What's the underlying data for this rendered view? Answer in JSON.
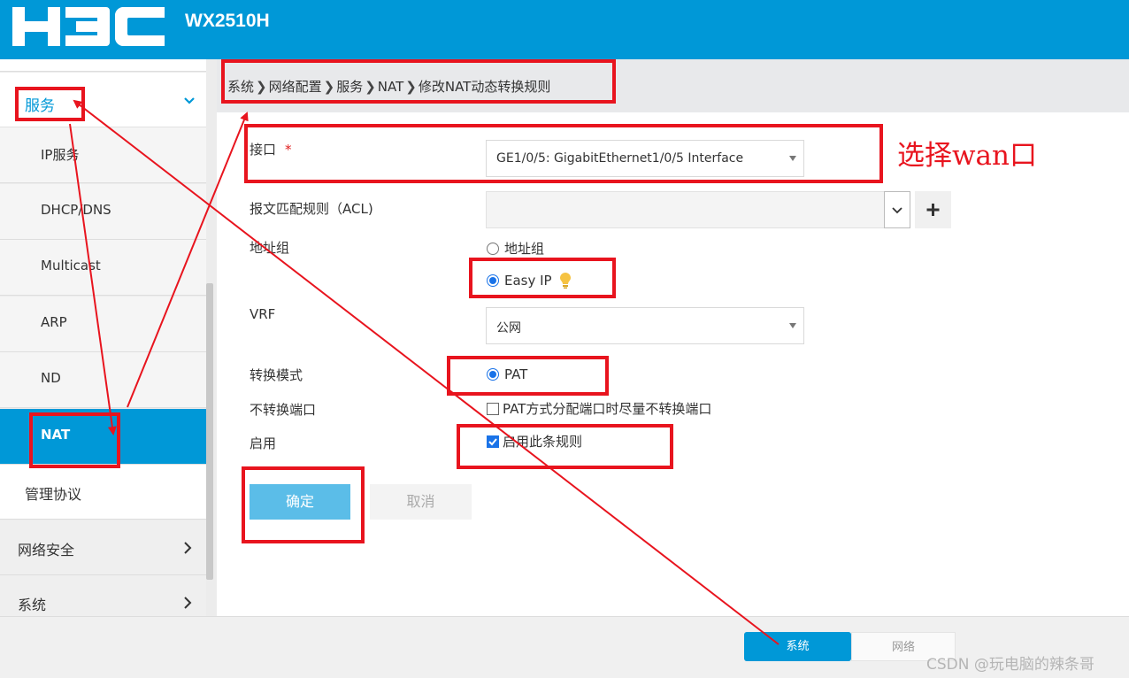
{
  "header": {
    "logo_text": "H3C",
    "model": "WX2510H"
  },
  "sidebar": {
    "service": {
      "label": "服务"
    },
    "sub_items": [
      {
        "label": "IP服务"
      },
      {
        "label": "DHCP/DNS"
      },
      {
        "label": "Multicast"
      },
      {
        "label": "ARP"
      },
      {
        "label": "ND"
      },
      {
        "label": "NAT"
      }
    ],
    "management_protocol": {
      "label": "管理协议"
    },
    "network_security": {
      "label": "网络安全"
    },
    "system": {
      "label": "系统"
    }
  },
  "breadcrumb": {
    "items": [
      "系统",
      "网络配置",
      "服务",
      "NAT",
      "修改NAT动态转换规则"
    ],
    "separator": "❯"
  },
  "form": {
    "interface": {
      "label": "接口",
      "required_mark": "*",
      "value": "GE1/0/5: GigabitEthernet1/0/5 Interface"
    },
    "acl": {
      "label": "报文匹配规则（ACL)",
      "value": "",
      "add_label": "+"
    },
    "address_group": {
      "label": "地址组",
      "option_address_group": "地址组",
      "option_easy_ip": "Easy IP",
      "selected": "Easy IP"
    },
    "vrf": {
      "label": "VRF",
      "value": "公网"
    },
    "translation_mode": {
      "label": "转换模式",
      "option": "PAT",
      "selected": "PAT"
    },
    "no_port_translation": {
      "label": "不转换端口",
      "checkbox_label": "PAT方式分配端口时尽量不转换端口",
      "checked": false
    },
    "enable": {
      "label": "启用",
      "checkbox_label": "启用此条规则",
      "checked": true
    },
    "ok_label": "确定",
    "cancel_label": "取消"
  },
  "bottom_tabs": {
    "system": "系统",
    "network": "网络",
    "active": "系统"
  },
  "annotation": {
    "note": "选择wan口"
  },
  "watermark": "CSDN @玩电脑的辣条哥",
  "colors": {
    "brand": "#0098d7",
    "annotation_red": "#e8141e",
    "ok_button": "#5bbde8",
    "radio_blue": "#1a73e8"
  },
  "icons": [
    "chevron-down-icon",
    "chevron-right-icon",
    "caret-down-icon",
    "plus-icon",
    "lightbulb-icon",
    "check-icon"
  ]
}
